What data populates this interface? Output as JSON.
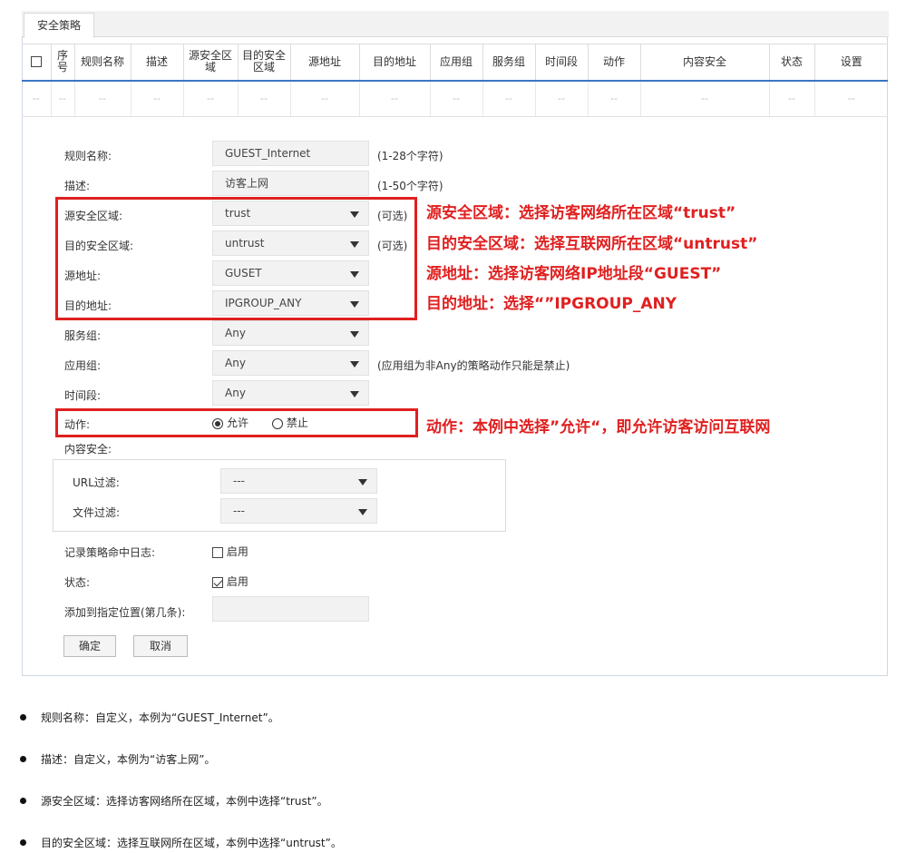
{
  "tab": "安全策略",
  "table": {
    "headers": [
      "序号",
      "规则名称",
      "描述",
      "源安全区域",
      "目的安全区域",
      "源地址",
      "目的地址",
      "应用组",
      "服务组",
      "时间段",
      "动作",
      "内容安全",
      "状态",
      "设置"
    ],
    "empty_cell": "--"
  },
  "form": {
    "rule_name": {
      "label": "规则名称:",
      "value": "GUEST_Internet",
      "hint": "(1-28个字符)"
    },
    "description": {
      "label": "描述:",
      "value": "访客上网",
      "hint": "(1-50个字符)"
    },
    "src_zone": {
      "label": "源安全区域:",
      "value": "trust",
      "hint": "(可选)"
    },
    "dst_zone": {
      "label": "目的安全区域:",
      "value": "untrust",
      "hint": "(可选)"
    },
    "src_addr": {
      "label": "源地址:",
      "value": "GUSET"
    },
    "dst_addr": {
      "label": "目的地址:",
      "value": "IPGROUP_ANY"
    },
    "service": {
      "label": "服务组:",
      "value": "Any"
    },
    "app": {
      "label": "应用组:",
      "value": "Any",
      "hint": "(应用组为非Any的策略动作只能是禁止)"
    },
    "time": {
      "label": "时间段:",
      "value": "Any"
    },
    "action": {
      "label": "动作:",
      "allow": "允许",
      "deny": "禁止"
    },
    "content_security": {
      "label": "内容安全:",
      "url_label": "URL过滤:",
      "url_value": "---",
      "file_label": "文件过滤:",
      "file_value": "---"
    },
    "log": {
      "label": "记录策略命中日志:",
      "text": "启用",
      "checked": false
    },
    "status": {
      "label": "状态:",
      "text": "启用",
      "checked": true
    },
    "position": {
      "label": "添加到指定位置(第几条):",
      "value": ""
    },
    "ok": "确定",
    "cancel": "取消"
  },
  "annotations": {
    "src_zone": "源安全区域：选择访客网络所在区域“trust”",
    "dst_zone": "目的安全区域：选择互联网所在区域“untrust”",
    "src_addr": "源地址：选择访客网络IP地址段“GUEST”",
    "dst_addr": "目的地址：选择“”IPGROUP_ANY",
    "action": "动作：本例中选择”允许“，即允许访客访问互联网",
    "color": "#e02020"
  },
  "bullets": [
    "规则名称：自定义，本例为“GUEST_Internet”。",
    "描述：自定义，本例为“访客上网”。",
    "源安全区域：选择访客网络所在区域，本例中选择“trust”。",
    "目的安全区域：选择互联网所在区域，本例中选择“untrust”。"
  ]
}
